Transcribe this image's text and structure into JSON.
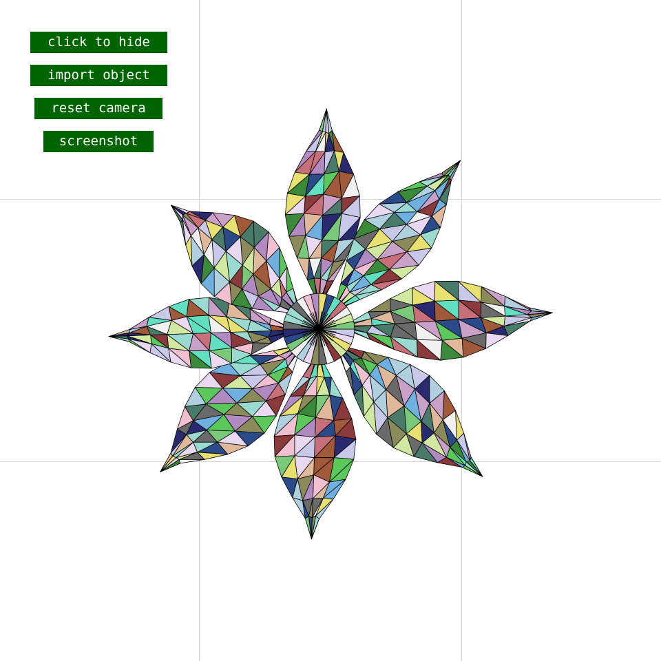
{
  "controls": {
    "hide_label": "click to hide",
    "import_label": "import object",
    "reset_label": "reset camera",
    "screenshot_label": "screenshot"
  },
  "scene": {
    "object": "petal-flower-mesh",
    "petal_count": 8,
    "render_mode": "flat-shaded-wireframe",
    "button_color": "#006400",
    "button_text_color": "#ffffff",
    "grid_color": "#d4d4d4",
    "edge_color": "#000000",
    "palette": [
      "#8a8a5a",
      "#e8d8f0",
      "#b08ac0",
      "#3a8a3a",
      "#9adad0",
      "#c8707a",
      "#5ac85a",
      "#2a4a8a",
      "#e0b89a",
      "#6a6a6a",
      "#d0e8a0",
      "#70b0e0",
      "#a05a3a",
      "#f0c0d0",
      "#4a7a6a",
      "#c8c8e8",
      "#e8e070",
      "#2a2a70",
      "#7ac87a",
      "#f0f0f0",
      "#b0d0e0",
      "#8a3a3a",
      "#c8a0c8",
      "#60e0c0"
    ]
  }
}
